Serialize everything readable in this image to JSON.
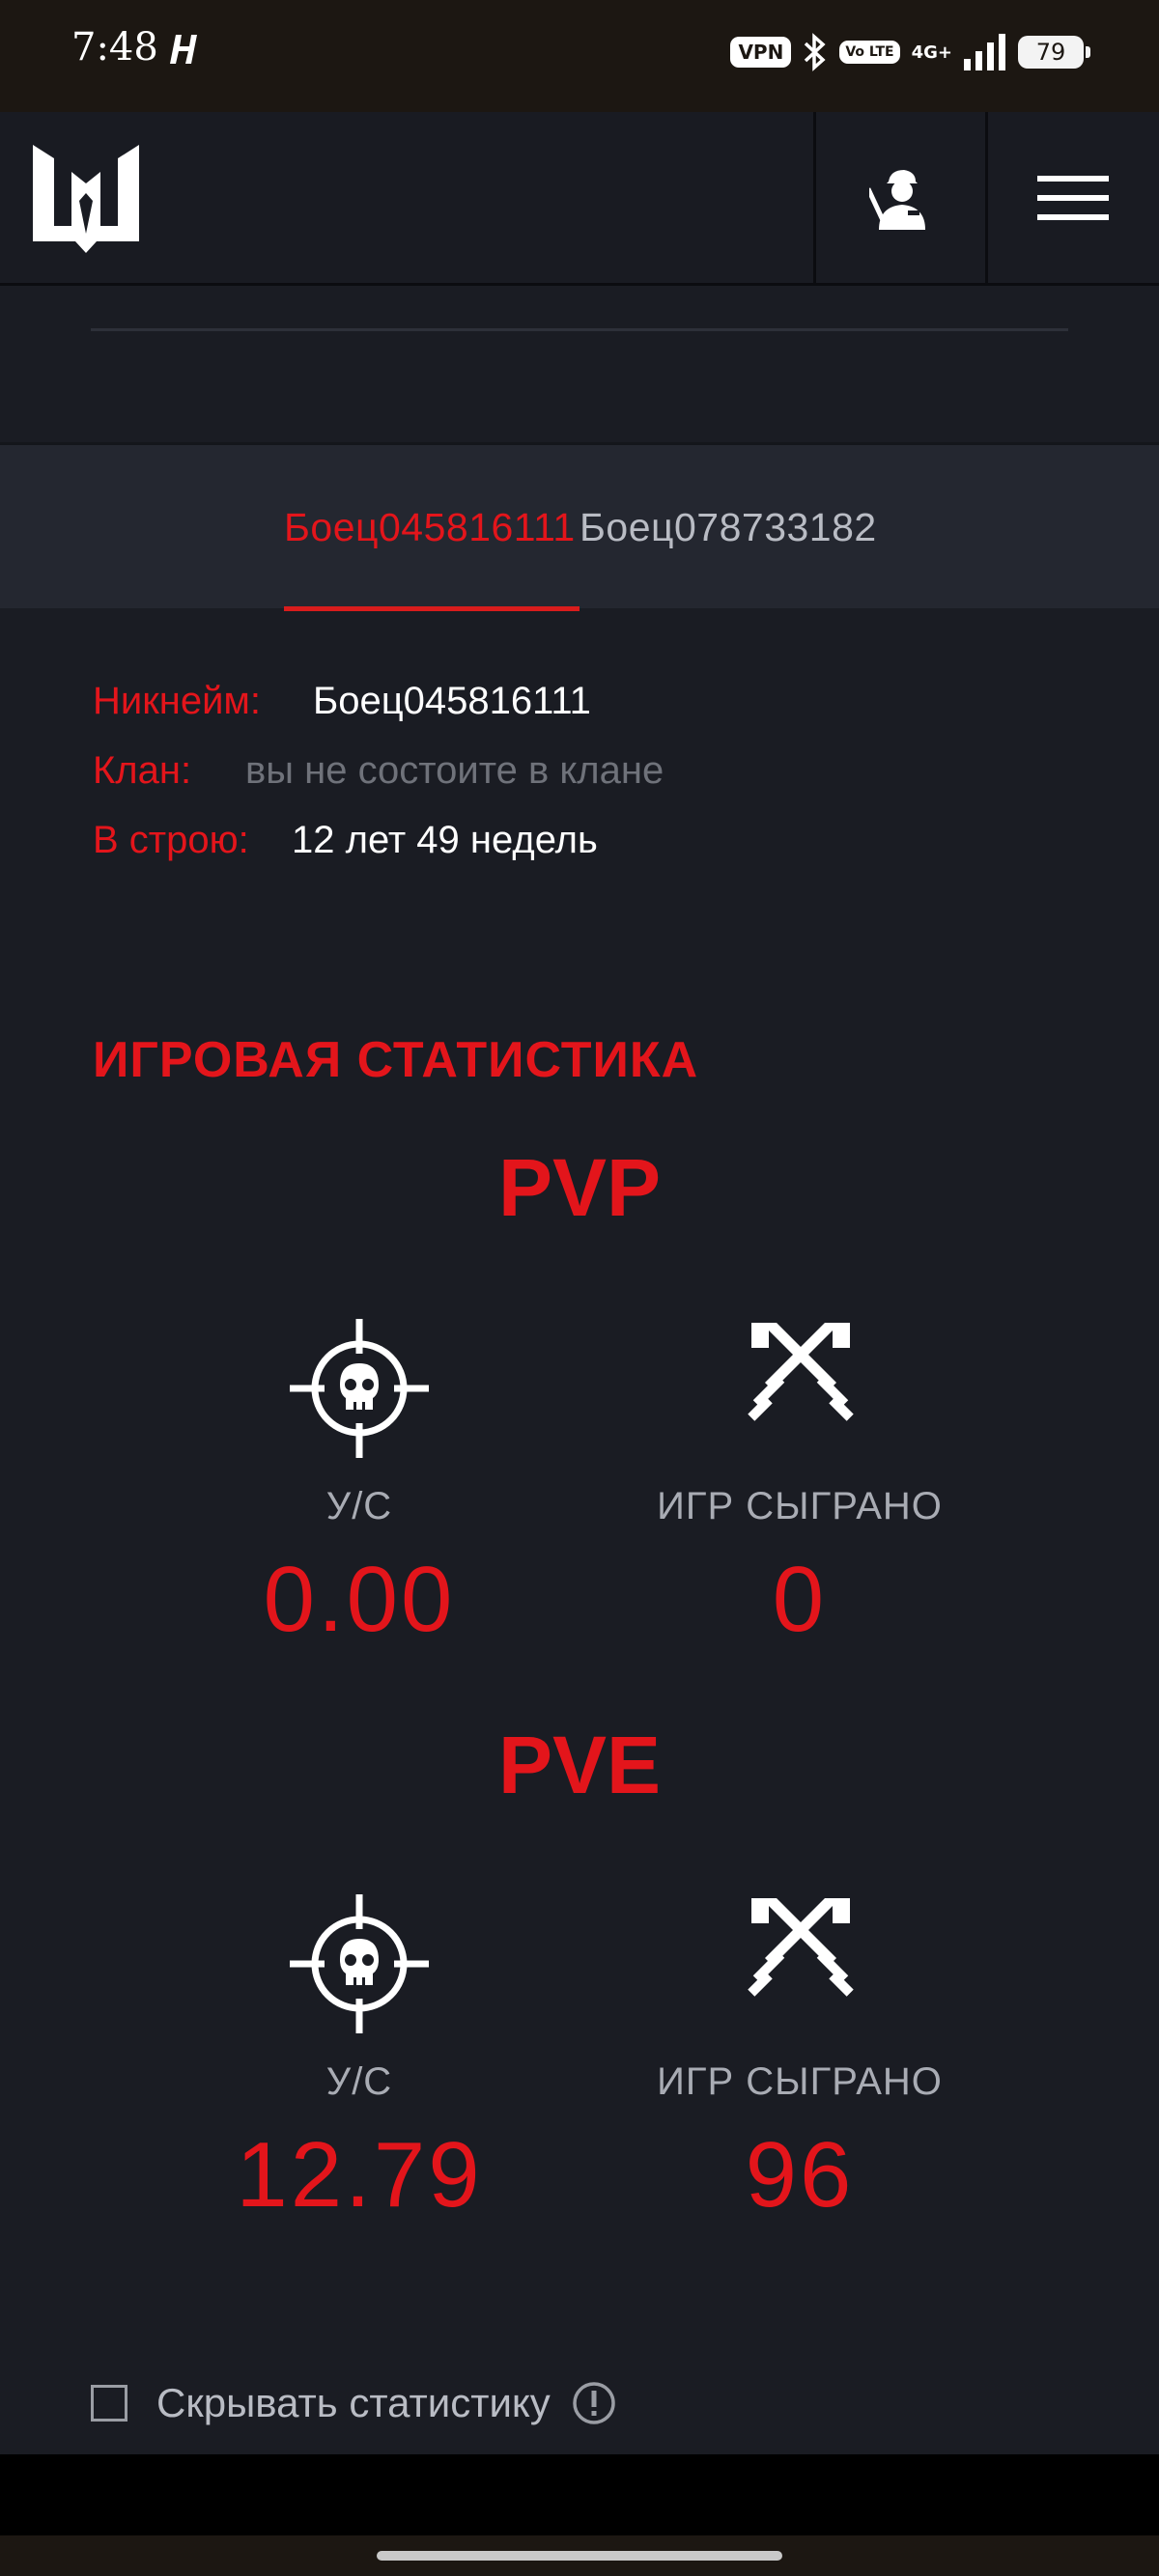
{
  "status_bar": {
    "time": "7:48",
    "vpn": "VPN",
    "volte": "Vo LTE",
    "network": "4G+",
    "battery": "79"
  },
  "nav": {
    "logo_icon": "warface-logo",
    "profile_icon": "soldier-profile-icon",
    "menu_icon": "hamburger-menu-icon"
  },
  "tabs": [
    {
      "label": "Боец045816111",
      "active": true
    },
    {
      "label": "Боец078733182",
      "active": false
    }
  ],
  "profile": {
    "nickname_label": "Никнейм:",
    "nickname_value": "Боец045816111",
    "clan_label": "Клан:",
    "clan_value": "вы не состоите в клане",
    "service_label": "В строю:",
    "service_value": "12 лет 49 недель"
  },
  "stats": {
    "title": "ИГРОВАЯ СТАТИСТИКА",
    "pvp": {
      "title": "PVP",
      "kd_label": "У/С",
      "kd_value": "0.00",
      "games_label": "ИГР СЫГРАНО",
      "games_value": "0"
    },
    "pve": {
      "title": "PVE",
      "kd_label": "У/С",
      "kd_value": "12.79",
      "games_label": "ИГР СЫГРАНО",
      "games_value": "96"
    }
  },
  "footer": {
    "hide_stats_label": "Скрывать статистику",
    "hide_stats_checked": false
  },
  "colors": {
    "accent": "#e3151b",
    "background": "#1a1c23",
    "tab_bg": "#242730"
  }
}
